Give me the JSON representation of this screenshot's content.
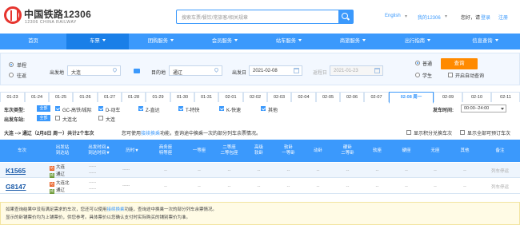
{
  "header": {
    "brand_cn": "中国铁路12306",
    "brand_en": "12306 CHINA RAILWAY",
    "search_placeholder": "搜索车票/餐饮/常旅客/相关规章",
    "lang": "English",
    "my12306": "我的12306",
    "greeting": "您好，请",
    "login": "登录",
    "register": "注册"
  },
  "nav": [
    {
      "label": "首页",
      "arrow": false
    },
    {
      "label": "车票",
      "arrow": true,
      "active": true
    },
    {
      "label": "团购服务",
      "arrow": true
    },
    {
      "label": "会员服务",
      "arrow": true
    },
    {
      "label": "站车服务",
      "arrow": true
    },
    {
      "label": "商旅服务",
      "arrow": true
    },
    {
      "label": "出行指南",
      "arrow": true
    },
    {
      "label": "信息查询",
      "arrow": true
    }
  ],
  "query": {
    "oneway": "单程",
    "roundtrip": "往返",
    "from_label": "出发地",
    "from_value": "大连",
    "to_label": "目的地",
    "to_value": "通辽",
    "depart_label": "出发日",
    "depart_value": "2021-02-08",
    "return_label": "返程日",
    "return_value": "2021-01-23",
    "normal": "普通",
    "student": "学生",
    "query_btn": "查询",
    "auto_query": "开启自动查询"
  },
  "dates": [
    "01-23",
    "01-24",
    "01-25",
    "01-26",
    "01-27",
    "01-28",
    "01-29",
    "01-30",
    "01-31",
    "02-01",
    "02-02",
    "02-03",
    "02-04",
    "02-05",
    "02-06",
    "02-07",
    "02-08 周一",
    "02-09",
    "02-10",
    "02-11"
  ],
  "filters": {
    "type_label": "车次类型:",
    "all": "全部",
    "types": [
      "GC-高铁/城际",
      "D-动车",
      "Z-直达",
      "T-特快",
      "K-快速",
      "其他"
    ],
    "from_station_label": "出发车站:",
    "stations": [
      "大连北",
      "大连"
    ],
    "depart_time_label": "发车时间:",
    "depart_time_value": "00:00--24:00"
  },
  "summary": {
    "route": "大连 --> 通辽（2月8日 周一）共计2个车次",
    "tip_prefix": "您可使用",
    "tip_link": "接续换乘",
    "tip_suffix": "功能，查询途中换乘一次的部分列车余票情况。",
    "opt1": "显示积分兑换车次",
    "opt2": "显示全部可预订车次"
  },
  "table": {
    "headers": [
      "车次",
      "出发站\n到达站",
      "出发时间▲\n到达时间▼",
      "历时▼",
      "商务座\n特等座",
      "一等座",
      "二等座\n二等包座",
      "高级\n软卧",
      "软卧\n一等卧",
      "动卧",
      "硬卧\n二等卧",
      "软座",
      "硬座",
      "无座",
      "其他",
      "备注"
    ],
    "rows": [
      {
        "train": "K1565",
        "from": "大连",
        "to": "通辽",
        "from_type": "始",
        "to_type": "终",
        "dep": "-----",
        "arr": "-----",
        "dur": "-----",
        "cells": [
          "--",
          "--",
          "--",
          "--",
          "--",
          "--",
          "--",
          "--",
          "--",
          "--",
          "--"
        ],
        "note": "列车停运"
      },
      {
        "train": "G8147",
        "from": "大连北",
        "to": "通辽",
        "from_type": "始",
        "to_type": "终",
        "dep": "-----",
        "arr": "-----",
        "dur": "-----",
        "cells": [
          "--",
          "--",
          "--",
          "--",
          "--",
          "--",
          "--",
          "--",
          "--",
          "--",
          "--"
        ],
        "note": "列车停运"
      }
    ]
  },
  "notice": {
    "line1_prefix": "如果查询结果中没有满足需求的车次，您还可以使用",
    "line1_link": "接续换乘",
    "line1_suffix": "功能，查询途中换乘一次的部分列车余票情况。",
    "line2": "显示的卧铺票价均为上铺票价，供您参考。具体票价以您确认支付时实际购买的铺别票价为准。"
  }
}
